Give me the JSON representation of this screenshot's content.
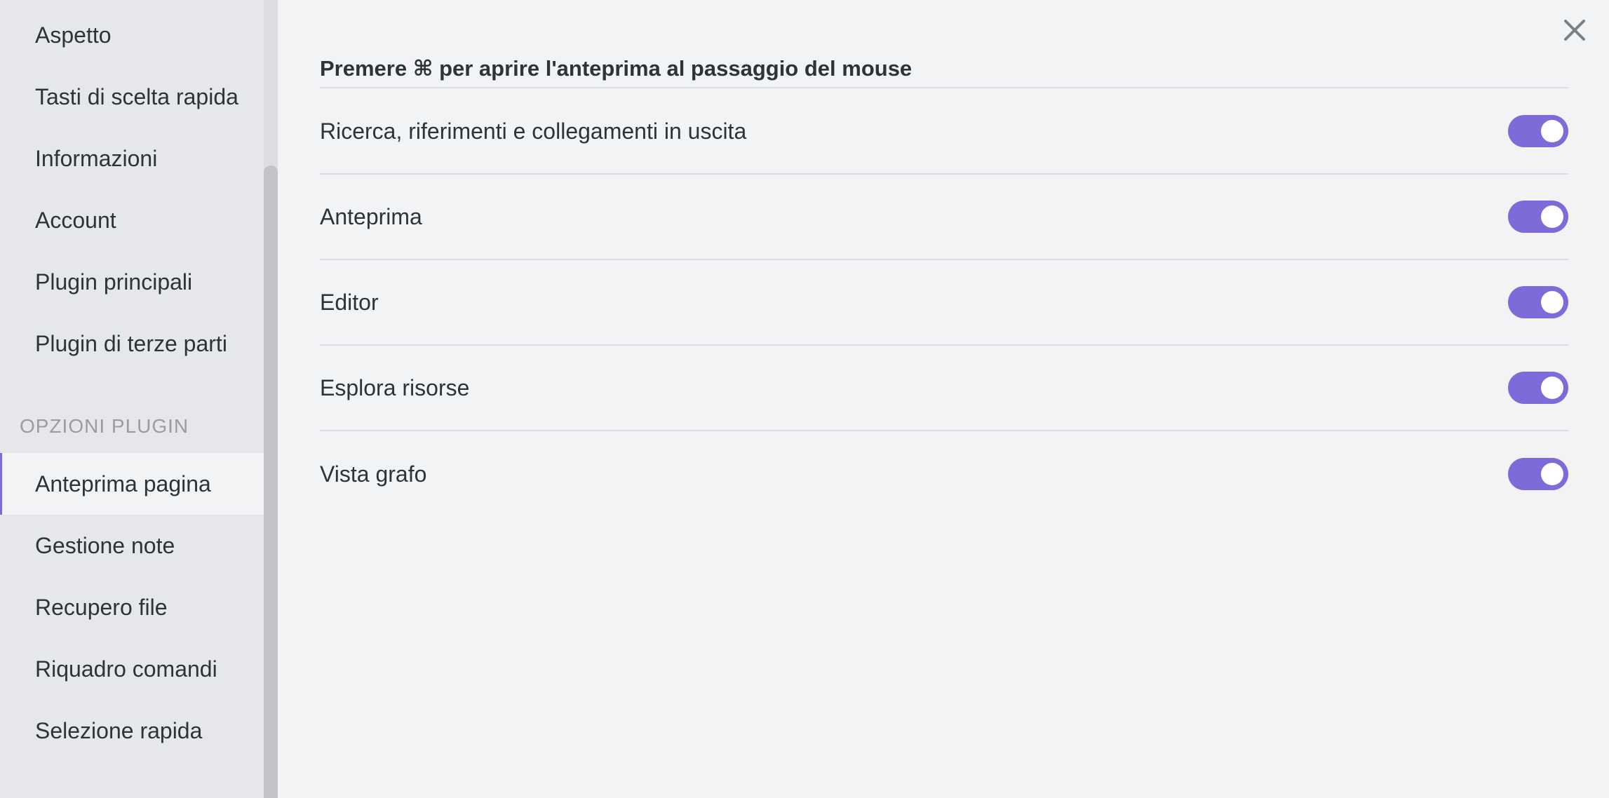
{
  "sidebar": {
    "items_top": [
      {
        "label": "Aspetto"
      },
      {
        "label": "Tasti di scelta rapida"
      },
      {
        "label": "Informazioni"
      },
      {
        "label": "Account"
      },
      {
        "label": "Plugin principali"
      },
      {
        "label": "Plugin di terze parti"
      }
    ],
    "section_label": "OPZIONI PLUGIN",
    "items_plugins": [
      {
        "label": "Anteprima pagina",
        "active": true
      },
      {
        "label": "Gestione note"
      },
      {
        "label": "Recupero file"
      },
      {
        "label": "Riquadro comandi"
      },
      {
        "label": "Selezione rapida"
      }
    ]
  },
  "main": {
    "heading": "Premere ⌘ per aprire l'anteprima al passaggio del mouse",
    "settings": [
      {
        "label": "Ricerca, riferimenti e collegamenti in uscita",
        "enabled": true
      },
      {
        "label": "Anteprima",
        "enabled": true
      },
      {
        "label": "Editor",
        "enabled": true
      },
      {
        "label": "Esplora risorse",
        "enabled": true
      },
      {
        "label": "Vista grafo",
        "enabled": true
      }
    ]
  },
  "icons": {
    "close": "close-icon"
  },
  "colors": {
    "accent": "#7b6cd9",
    "sidebar_bg": "#e6e7ea",
    "main_bg": "#f2f3f5"
  }
}
